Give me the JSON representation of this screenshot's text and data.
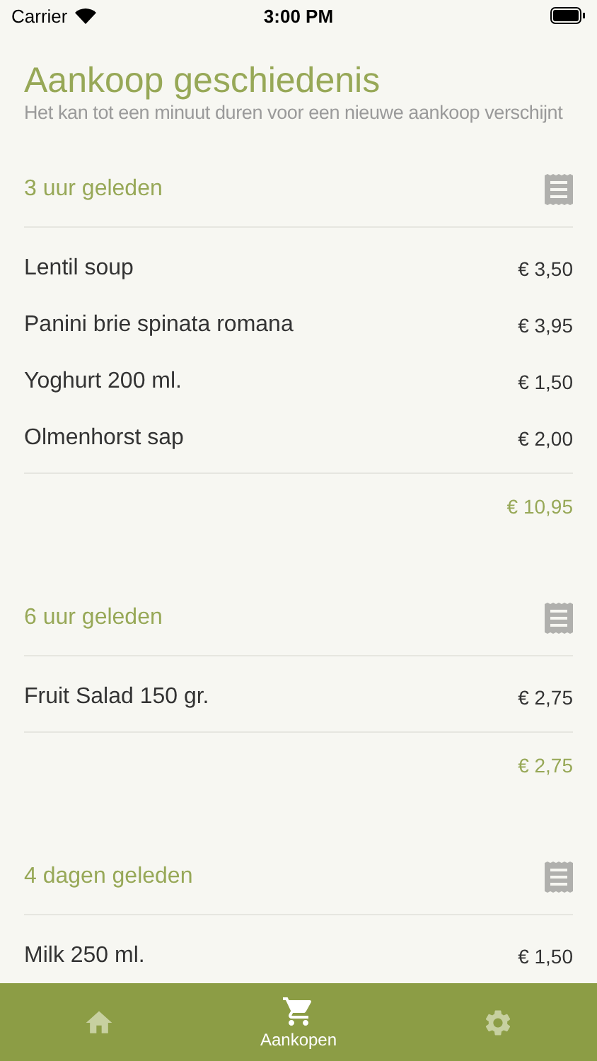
{
  "status_bar": {
    "carrier": "Carrier",
    "time": "3:00 PM"
  },
  "header": {
    "title": "Aankoop geschiedenis",
    "subtitle": "Het kan tot een minuut duren voor een nieuwe aankoop verschijnt"
  },
  "purchases": [
    {
      "when": "3 uur geleden",
      "items": [
        {
          "name": "Lentil soup",
          "price": "€ 3,50"
        },
        {
          "name": "Panini brie spinata romana",
          "price": "€ 3,95"
        },
        {
          "name": "Yoghurt 200 ml.",
          "price": "€ 1,50"
        },
        {
          "name": "Olmenhorst sap",
          "price": "€ 2,00"
        }
      ],
      "total": "€ 10,95"
    },
    {
      "when": "6 uur geleden",
      "items": [
        {
          "name": "Fruit Salad 150 gr.",
          "price": "€ 2,75"
        }
      ],
      "total": "€ 2,75"
    },
    {
      "when": "4 dagen geleden",
      "items": [
        {
          "name": "Milk 250 ml.",
          "price": "€ 1,50"
        }
      ]
    }
  ],
  "tab_bar": [
    {
      "kind": "home",
      "selected": false
    },
    {
      "kind": "cart",
      "label": "Aankopen",
      "selected": true
    },
    {
      "kind": "settings",
      "selected": false
    }
  ]
}
